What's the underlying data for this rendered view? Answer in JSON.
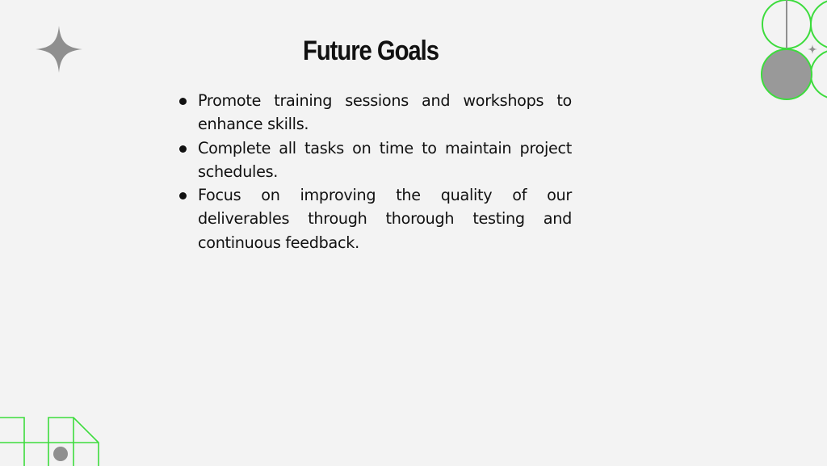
{
  "slide": {
    "title": "Future Goals",
    "bullets": [
      "Promote training sessions and workshops to enhance skills.",
      "Complete all tasks on time to maintain project schedules.",
      "Focus on improving the quality of our deliverables through thorough testing and continuous feedback."
    ]
  },
  "colors": {
    "background": "#f3f3f3",
    "text": "#111111",
    "accent_green": "#3ddc3d",
    "decor_gray": "#8f8f8f"
  },
  "icons": [
    "four-point-star-icon",
    "small-star-icon"
  ]
}
